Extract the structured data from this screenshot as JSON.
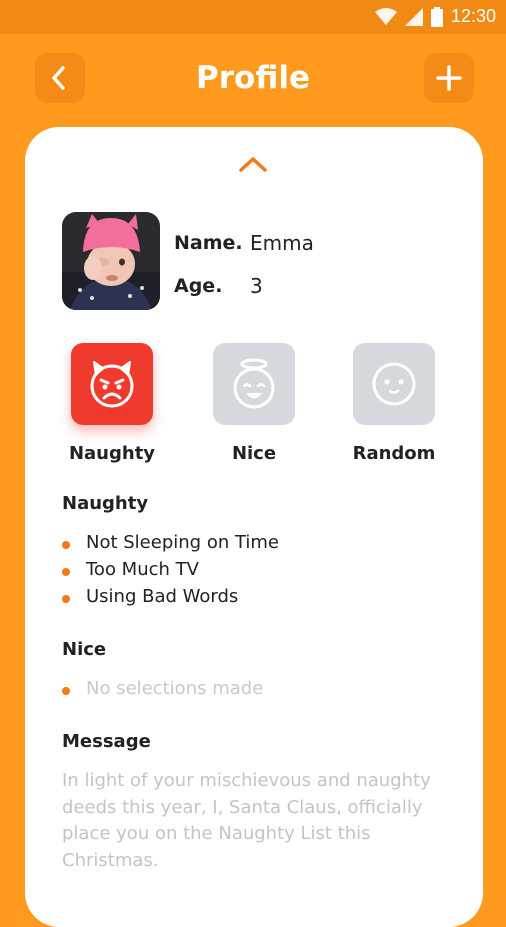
{
  "status_bar": {
    "time": "12:30",
    "icons": [
      "wifi-icon",
      "signal-icon",
      "battery-icon"
    ]
  },
  "header": {
    "title": "Profile",
    "back_icon": "chevron-left-icon",
    "add_icon": "plus-icon"
  },
  "profile": {
    "name_label": "Name.",
    "name_value": "Emma",
    "age_label": "Age.",
    "age_value": "3"
  },
  "moods": [
    {
      "label": "Naughty",
      "icon": "devil-face-icon",
      "selected": true
    },
    {
      "label": "Nice",
      "icon": "angel-face-icon",
      "selected": false
    },
    {
      "label": "Random",
      "icon": "neutral-face-icon",
      "selected": false
    }
  ],
  "naughty_section": {
    "title": "Naughty",
    "items": [
      "Not Sleeping on Time",
      "Too Much TV",
      "Using Bad Words"
    ]
  },
  "nice_section": {
    "title": "Nice",
    "items": [
      "No selections made"
    ]
  },
  "message_section": {
    "title": "Message",
    "text": "In light of your mischievous and naughty deeds this year, I, Santa Claus, officially place you on the Naughty List this Christmas."
  },
  "colors": {
    "background": "#FF9A1F",
    "status_bar": "#F08A14",
    "naughty_accent": "#F03A2E",
    "inactive_mood": "#D5D9DE",
    "bullet": "#F37A16"
  }
}
